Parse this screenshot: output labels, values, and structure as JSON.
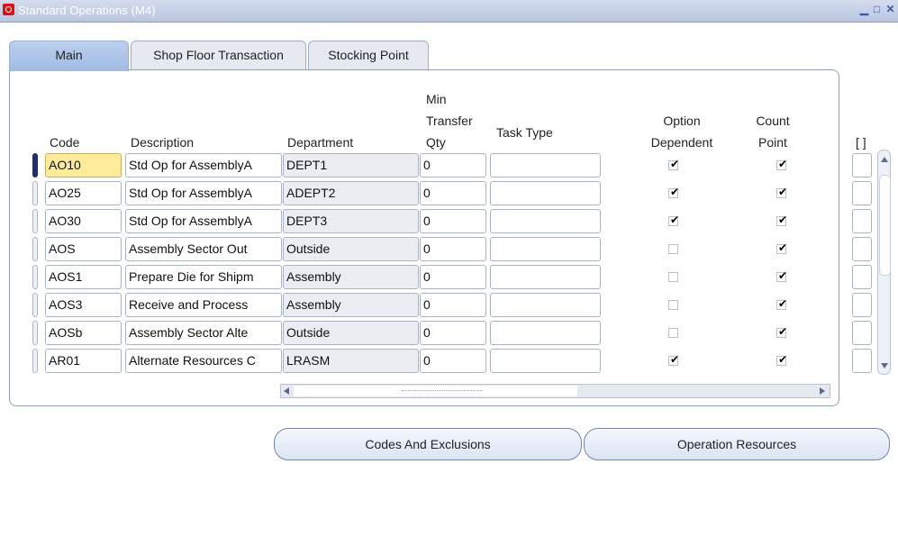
{
  "window": {
    "title": "Standard Operations (M4)"
  },
  "tabs": [
    {
      "label": "Main"
    },
    {
      "label": "Shop Floor Transaction"
    },
    {
      "label": "Stocking Point"
    }
  ],
  "columns": {
    "code": "Code",
    "description": "Description",
    "department": "Department",
    "min_transfer_qty_1": "Min",
    "min_transfer_qty_2": "Transfer",
    "min_transfer_qty_3": "Qty",
    "task_type": "Task Type",
    "option_dependent_1": "Option",
    "option_dependent_2": "Dependent",
    "count_point_1": "Count",
    "count_point_2": "Point",
    "folder": "[ ]"
  },
  "rows": [
    {
      "code": "AO10",
      "description": "Std Op for AssemblyA",
      "department": "DEPT1",
      "min_qty": "0",
      "task_type": "",
      "option_dependent": true,
      "count_point": true
    },
    {
      "code": "AO25",
      "description": "Std Op for AssemblyA",
      "department": "ADEPT2",
      "min_qty": "0",
      "task_type": "",
      "option_dependent": true,
      "count_point": true
    },
    {
      "code": "AO30",
      "description": "Std Op for AssemblyA",
      "department": "DEPT3",
      "min_qty": "0",
      "task_type": "",
      "option_dependent": true,
      "count_point": true
    },
    {
      "code": "AOS",
      "description": "Assembly Sector Out",
      "department": "Outside",
      "min_qty": "0",
      "task_type": "",
      "option_dependent": false,
      "count_point": true
    },
    {
      "code": "AOS1",
      "description": "Prepare Die for Shipm",
      "department": "Assembly",
      "min_qty": "0",
      "task_type": "",
      "option_dependent": false,
      "count_point": true
    },
    {
      "code": "AOS3",
      "description": "Receive and Process",
      "department": "Assembly",
      "min_qty": "0",
      "task_type": "",
      "option_dependent": false,
      "count_point": true
    },
    {
      "code": "AOSb",
      "description": "Assembly Sector Alte",
      "department": "Outside",
      "min_qty": "0",
      "task_type": "",
      "option_dependent": false,
      "count_point": true
    },
    {
      "code": "AR01",
      "description": "Alternate Resources C",
      "department": "LRASM",
      "min_qty": "0",
      "task_type": "",
      "option_dependent": true,
      "count_point": true
    }
  ],
  "buttons": {
    "codes_and_exclusions": "Codes And Exclusions",
    "operation_resources": "Operation Resources"
  },
  "icons": {
    "window_logo": "oracle-logo-icon",
    "minimize": "minimize-icon",
    "restore": "restore-icon",
    "close": "close-icon",
    "checkbox_tick": "✔"
  },
  "colors": {
    "current_field": "#ffeb9a",
    "readonly_field": "#ebedf2",
    "active_tab": "#a0bbe4",
    "logo_red": "#e30f0f"
  }
}
